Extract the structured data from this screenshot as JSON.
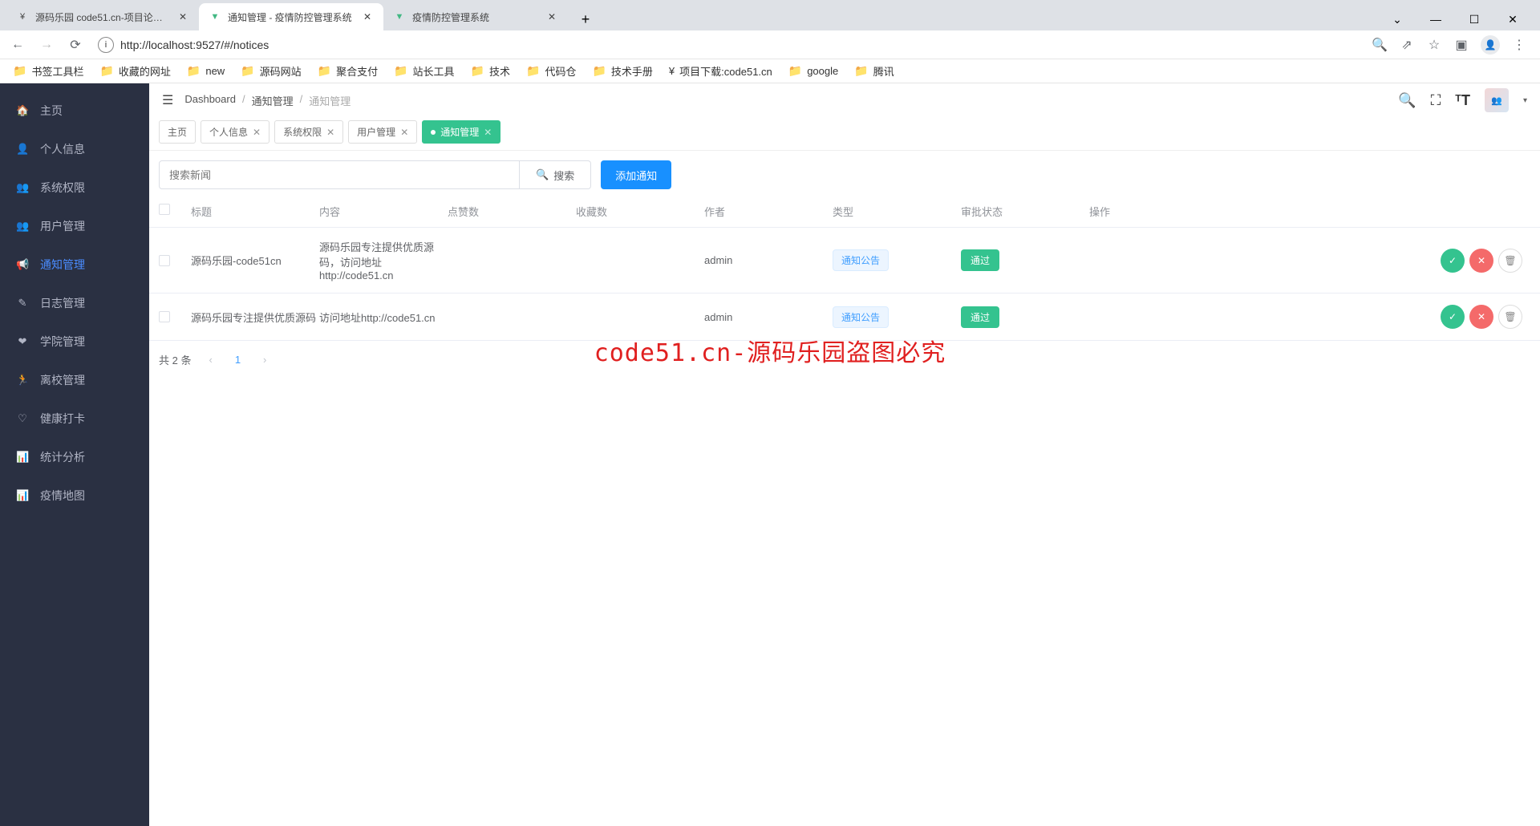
{
  "browser": {
    "tabs": [
      {
        "title": "源码乐园 code51.cn-项目论文代"
      },
      {
        "title": "通知管理 - 疫情防控管理系统"
      },
      {
        "title": "疫情防控管理系统"
      }
    ],
    "url": "http://localhost:9527/#/notices",
    "bookmarks": [
      "书签工具栏",
      "收藏的网址",
      "new",
      "源码网站",
      "聚合支付",
      "站长工具",
      "技术",
      "代码仓",
      "技术手册",
      "项目下载:code51.cn",
      "google",
      "腾讯"
    ]
  },
  "sidebar": {
    "items": [
      "主页",
      "个人信息",
      "系统权限",
      "用户管理",
      "通知管理",
      "日志管理",
      "学院管理",
      "离校管理",
      "健康打卡",
      "统计分析",
      "疫情地图"
    ],
    "active": 4,
    "icons": [
      "🏠",
      "👤",
      "👥",
      "👥",
      "📢",
      "✎",
      "❤",
      "🏃",
      "♡",
      "📊",
      "📊"
    ]
  },
  "breadcrumb": [
    "Dashboard",
    "通知管理",
    "通知管理"
  ],
  "viewTabs": [
    {
      "label": "主页",
      "closable": false
    },
    {
      "label": "个人信息",
      "closable": true
    },
    {
      "label": "系统权限",
      "closable": true
    },
    {
      "label": "用户管理",
      "closable": true
    },
    {
      "label": "通知管理",
      "closable": true,
      "active": true
    }
  ],
  "toolbar": {
    "searchPlaceholder": "搜索新闻",
    "searchBtn": "搜索",
    "addBtn": "添加通知"
  },
  "table": {
    "headers": {
      "title": "标题",
      "content": "内容",
      "likes": "点赞数",
      "favs": "收藏数",
      "author": "作者",
      "type": "类型",
      "status": "审批状态",
      "ops": "操作"
    },
    "rows": [
      {
        "title": "源码乐园-code51cn",
        "content": "源码乐园专注提供优质源码，访问地址http://code51.cn",
        "author": "admin",
        "type": "通知公告",
        "status": "通过"
      },
      {
        "title": "源码乐园专注提供优质源码",
        "content": "访问地址http://code51.cn",
        "author": "admin",
        "type": "通知公告",
        "status": "通过"
      }
    ]
  },
  "pagination": {
    "total": "共 2 条",
    "current": "1"
  },
  "watermark": "code51.cn-源码乐园盗图必究"
}
